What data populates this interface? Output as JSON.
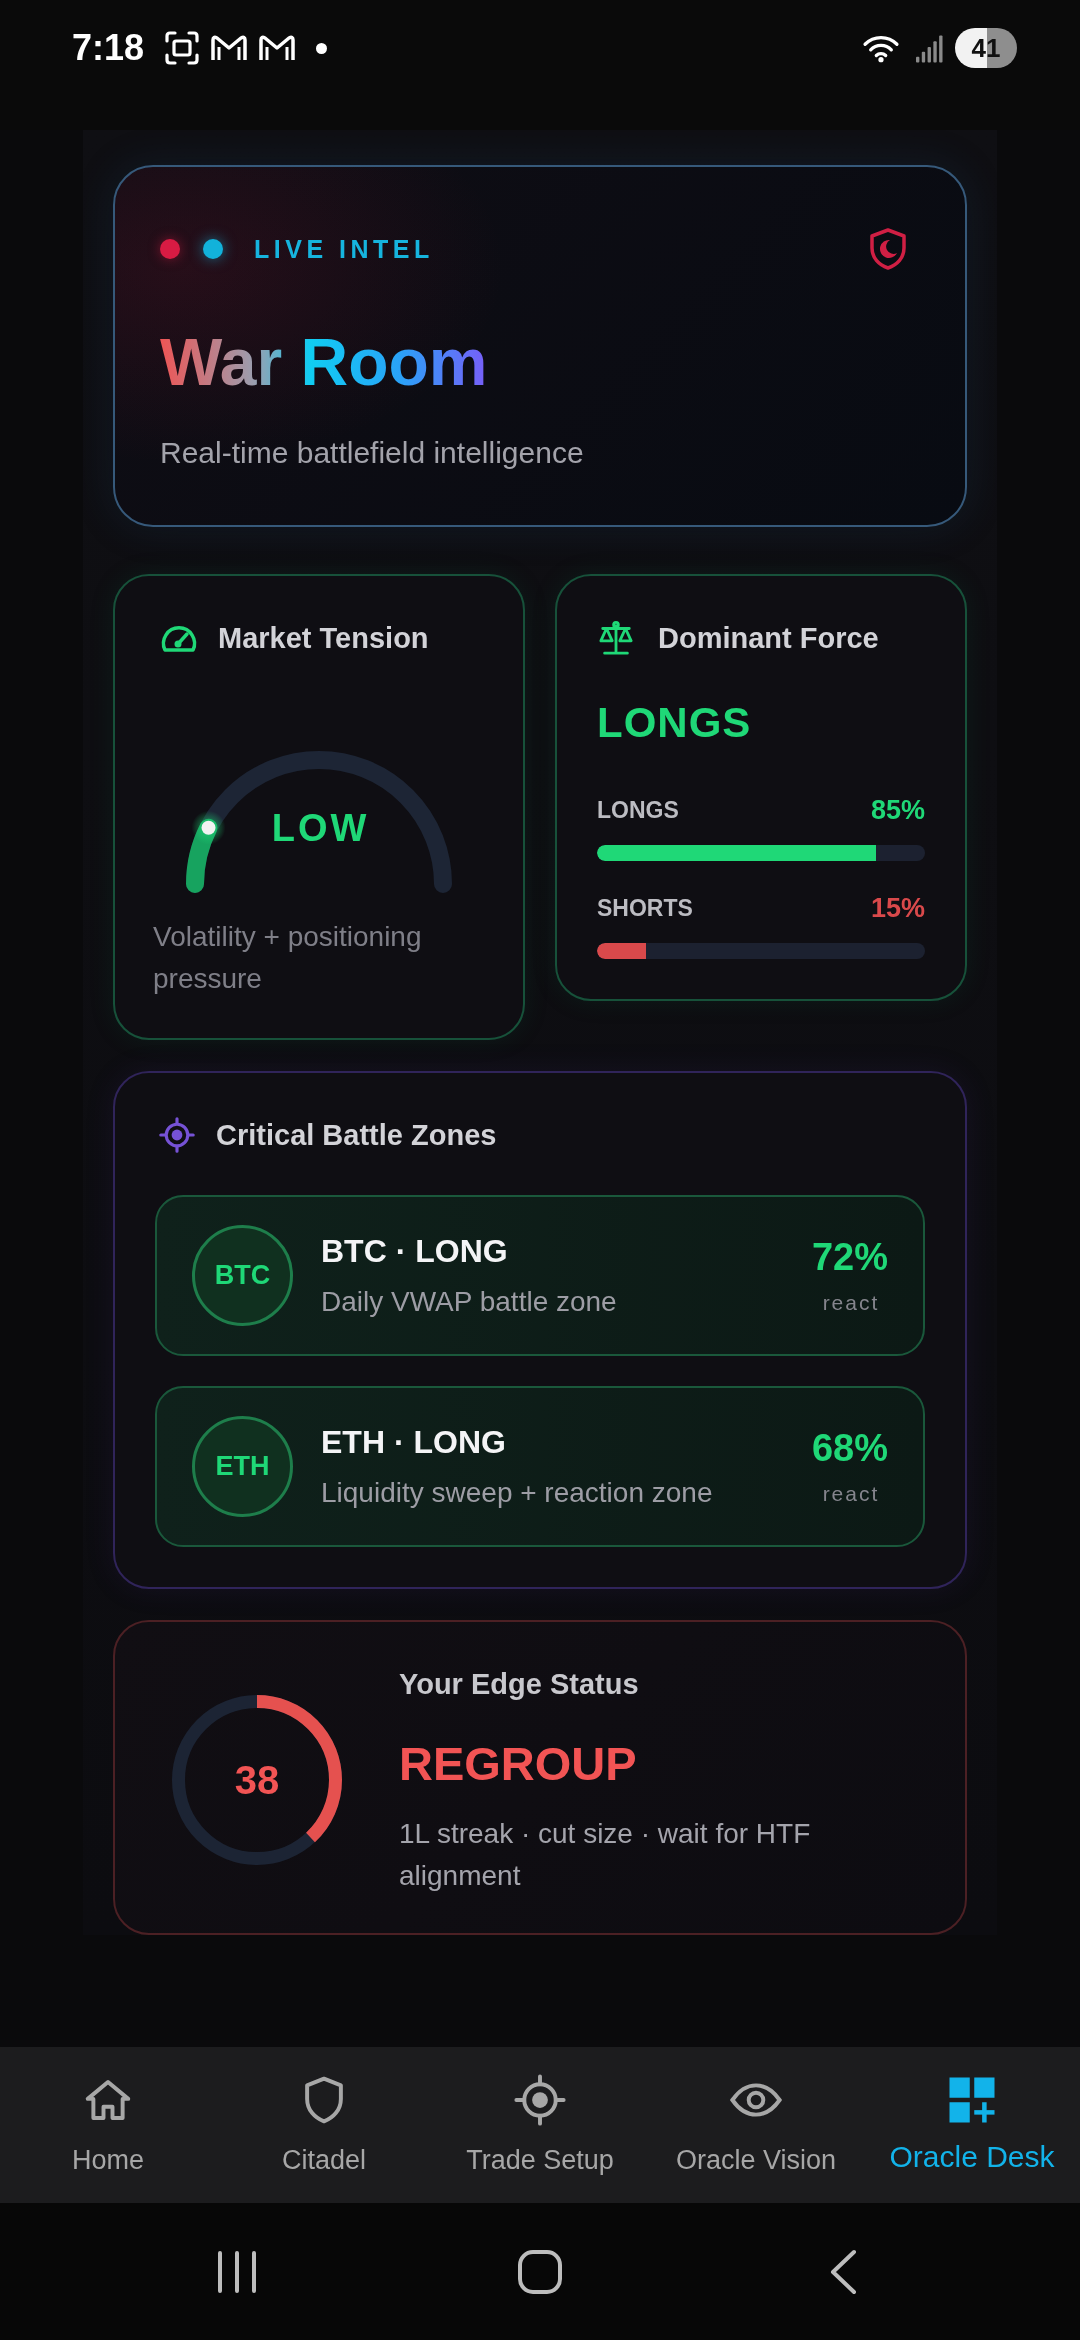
{
  "status_bar": {
    "time": "7:18",
    "battery": "41"
  },
  "header": {
    "badge": "LIVE INTEL",
    "title": "War Room",
    "subtitle": "Real-time battlefield intelligence"
  },
  "market_tension": {
    "title": "Market Tension",
    "reading": "LOW",
    "level": 0.15,
    "description": "Volatility + positioning pressure"
  },
  "dominant_force": {
    "title": "Dominant Force",
    "leader": "LONGS",
    "sides": [
      {
        "label": "LONGS",
        "value": "85%",
        "level": 0.85,
        "color": "#1fd877"
      },
      {
        "label": "SHORTS",
        "value": "15%",
        "level": 0.15,
        "color": "#d9494b"
      }
    ]
  },
  "battle_zones": {
    "title": "Critical Battle Zones",
    "zones": [
      {
        "symbol": "BTC",
        "title": "BTC · LONG",
        "description": "Daily VWAP battle zone",
        "probability": "72%",
        "caption": "react"
      },
      {
        "symbol": "ETH",
        "title": "ETH · LONG",
        "description": "Liquidity sweep + reaction zone",
        "probability": "68%",
        "caption": "react"
      }
    ]
  },
  "edge_status": {
    "title": "Your Edge Status",
    "score": "38",
    "level": 0.38,
    "verdict": "REGROUP",
    "description": "1L streak · cut size · wait for HTF alignment"
  },
  "bottom_nav": [
    {
      "label": "Home",
      "selected": false
    },
    {
      "label": "Citadel",
      "selected": false
    },
    {
      "label": "Trade Setup",
      "selected": false
    },
    {
      "label": "Oracle Vision",
      "selected": false
    },
    {
      "label": "Oracle Desk",
      "selected": true
    }
  ]
}
